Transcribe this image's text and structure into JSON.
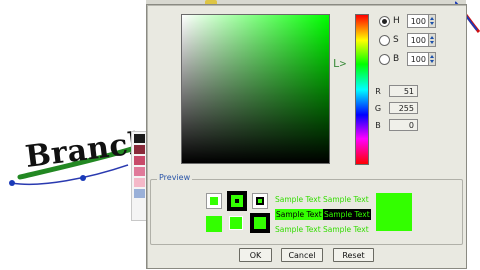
{
  "background": {
    "word": "Branch",
    "swatch_colors": [
      "#1a1a1a",
      "#8a2a3a",
      "#c84a6a",
      "#e07a9a",
      "#f4b8c8",
      "#9ab0d8"
    ]
  },
  "dialog": {
    "hsb": [
      {
        "label": "H",
        "value": "100",
        "selected": true
      },
      {
        "label": "S",
        "value": "100",
        "selected": false
      },
      {
        "label": "B",
        "value": "100",
        "selected": false
      }
    ],
    "rgb": [
      {
        "label": "R",
        "value": "51"
      },
      {
        "label": "G",
        "value": "255"
      },
      {
        "label": "B",
        "value": "0"
      }
    ],
    "hue_arrow": "L>",
    "preview": {
      "title": "Preview",
      "sample_text": "Sample Text",
      "color": "#33ff00"
    },
    "buttons": {
      "ok": "OK",
      "cancel": "Cancel",
      "reset": "Reset"
    }
  }
}
